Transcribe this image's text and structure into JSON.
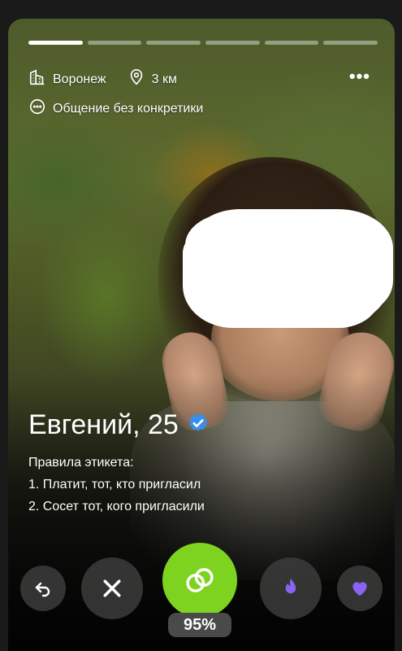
{
  "profile": {
    "city": "Воронеж",
    "distance": "3 км",
    "intent": "Общение без конкретики",
    "name_age": "Евгений, 25",
    "etiquette_title": "Правила этикета:",
    "rule_1": "1. Платит, тот, кто пригласил",
    "rule_2": "2. Сосет тот, кого пригласили",
    "match_percent": "95%"
  },
  "story_progress": {
    "segments": 6,
    "active_index": 0
  },
  "icons": {
    "city": "building-icon",
    "distance": "location-pin-icon",
    "intent": "chat-bubble-icon",
    "menu": "more-dots-icon",
    "verified": "verified-badge-icon",
    "undo": "undo-icon",
    "dislike": "close-icon",
    "match": "rings-icon",
    "boost": "flame-icon",
    "like": "heart-icon"
  },
  "colors": {
    "match_green": "#7ed321",
    "verified_blue": "#3a8ee6",
    "boost_purple": "#8a63f0",
    "like_purple": "#8a63f0"
  },
  "menu_label": "•••"
}
